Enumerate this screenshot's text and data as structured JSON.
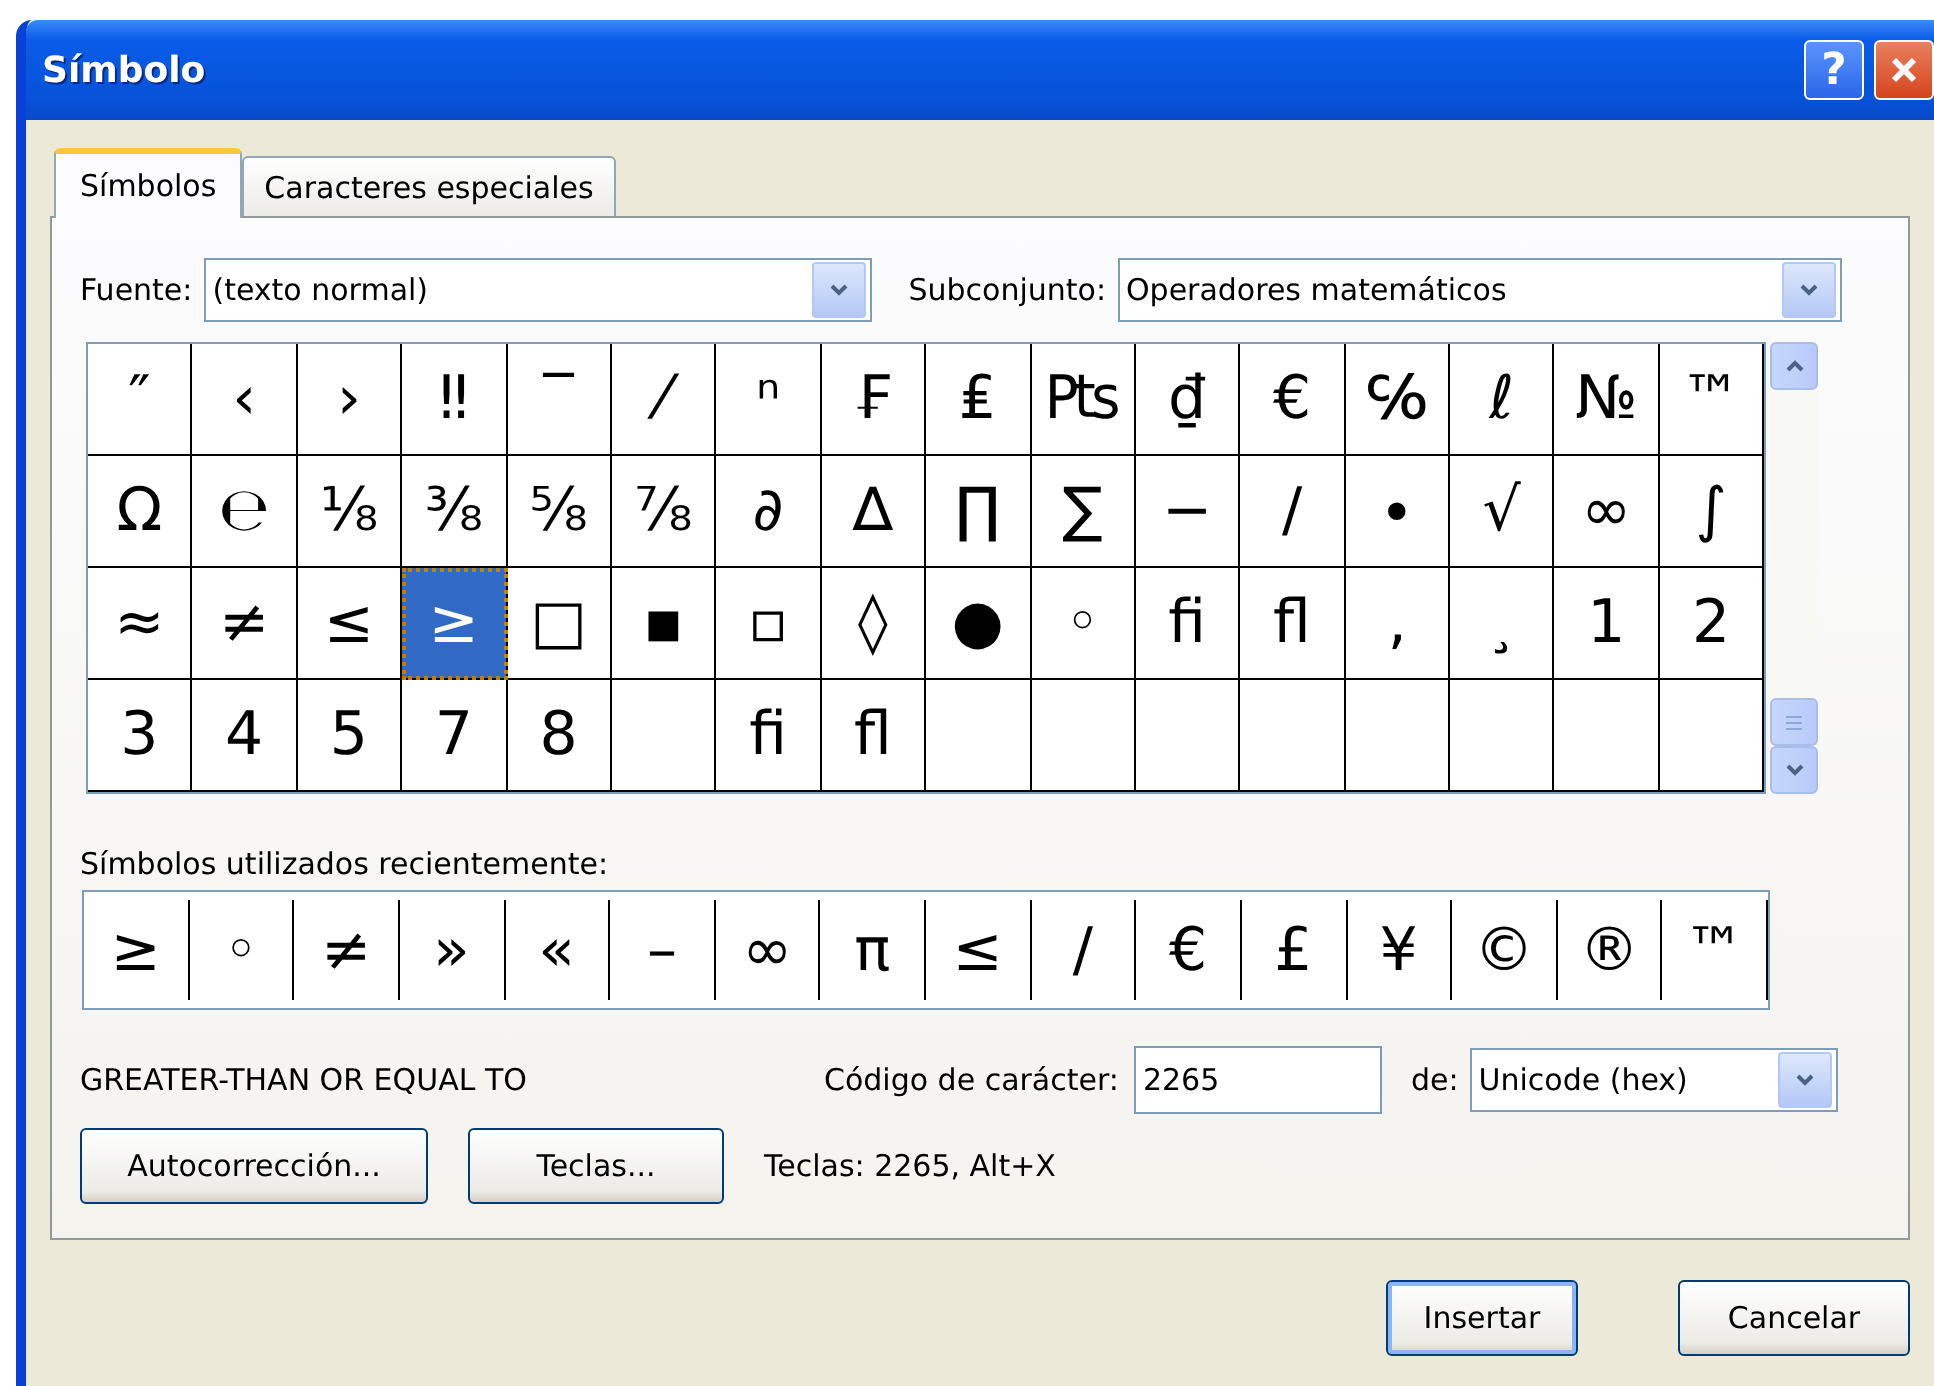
{
  "window": {
    "title": "Símbolo"
  },
  "title_buttons": [
    {
      "kind": "help",
      "label": "?"
    },
    {
      "kind": "close"
    }
  ],
  "tabs": [
    {
      "label": "Símbolos",
      "selected": true
    },
    {
      "label": "Caracteres especiales",
      "selected": false
    }
  ],
  "font": {
    "label": "Fuente:",
    "value": "(texto normal)"
  },
  "subset": {
    "label": "Subconjunto:",
    "value": "Operadores matemáticos"
  },
  "grid": {
    "rows": [
      [
        {
          "char": "″",
          "selected": false
        },
        {
          "char": "‹",
          "selected": false
        },
        {
          "char": "›",
          "selected": false
        },
        {
          "char": "‼",
          "selected": false
        },
        {
          "char": "‾",
          "selected": false
        },
        {
          "char": "⁄",
          "selected": false
        },
        {
          "char": "ⁿ",
          "selected": false
        },
        {
          "char": "₣",
          "selected": false
        },
        {
          "char": "₤",
          "selected": false
        },
        {
          "char": "₧",
          "selected": false
        },
        {
          "char": "₫",
          "selected": false
        },
        {
          "char": "€",
          "selected": false
        },
        {
          "char": "℅",
          "selected": false
        },
        {
          "char": "ℓ",
          "selected": false
        },
        {
          "char": "№",
          "selected": false
        },
        {
          "char": "™",
          "selected": false
        }
      ],
      [
        {
          "char": "Ω",
          "selected": false
        },
        {
          "char": "℮",
          "selected": false
        },
        {
          "char": "⅛",
          "selected": false
        },
        {
          "char": "⅜",
          "selected": false
        },
        {
          "char": "⅝",
          "selected": false
        },
        {
          "char": "⅞",
          "selected": false
        },
        {
          "char": "∂",
          "selected": false
        },
        {
          "char": "∆",
          "selected": false
        },
        {
          "char": "∏",
          "selected": false
        },
        {
          "char": "∑",
          "selected": false
        },
        {
          "char": "−",
          "selected": false
        },
        {
          "char": "∕",
          "selected": false
        },
        {
          "char": "∙",
          "selected": false
        },
        {
          "char": "√",
          "selected": false
        },
        {
          "char": "∞",
          "selected": false
        },
        {
          "char": "∫",
          "selected": false
        }
      ],
      [
        {
          "char": "≈",
          "selected": false
        },
        {
          "char": "≠",
          "selected": false
        },
        {
          "char": "≤",
          "selected": false
        },
        {
          "char": "≥",
          "selected": true
        },
        {
          "char": "□",
          "selected": false
        },
        {
          "char": "▪",
          "selected": false
        },
        {
          "char": "▫",
          "selected": false
        },
        {
          "char": "◊",
          "selected": false
        },
        {
          "char": "●",
          "selected": false
        },
        {
          "char": "◦",
          "selected": false
        },
        {
          "char": "ﬁ",
          "selected": false
        },
        {
          "char": "ﬂ",
          "selected": false
        },
        {
          "char": "‚",
          "selected": false
        },
        {
          "char": "¸",
          "selected": false
        },
        {
          "char": "1",
          "selected": false
        },
        {
          "char": "2",
          "selected": false
        }
      ],
      [
        {
          "char": "3",
          "selected": false
        },
        {
          "char": "4",
          "selected": false
        },
        {
          "char": "5",
          "selected": false
        },
        {
          "char": "7",
          "selected": false
        },
        {
          "char": "8",
          "selected": false
        },
        {
          "selected": false
        },
        {
          "char": "ﬁ",
          "selected": false
        },
        {
          "char": "ﬂ",
          "selected": false
        },
        {
          "selected": false
        },
        {
          "selected": false
        },
        {
          "selected": false
        },
        {
          "selected": false
        },
        {
          "selected": false
        },
        {
          "selected": false
        },
        {
          "selected": false
        },
        {
          "selected": false
        }
      ]
    ]
  },
  "recent": {
    "label": "Símbolos utilizados recientemente:",
    "chars": [
      "≥",
      "◦",
      "≠",
      "»",
      "«",
      "–",
      "∞",
      "π",
      "≤",
      "/",
      "€",
      "£",
      "¥",
      "©",
      "®",
      "™"
    ]
  },
  "char_name": "GREATER-THAN OR EQUAL TO",
  "code": {
    "label": "Código de carácter:",
    "value": "2265"
  },
  "from": {
    "label": "de:",
    "value": "Unicode (hex)"
  },
  "buttons": [
    {
      "label": "Autocorrección..."
    },
    {
      "label": "Teclas..."
    }
  ],
  "shortcut": "Teclas: 2265, Alt+X",
  "dialog_buttons": [
    {
      "label": "Insertar",
      "default": true
    },
    {
      "label": "Cancelar",
      "default": false
    }
  ]
}
